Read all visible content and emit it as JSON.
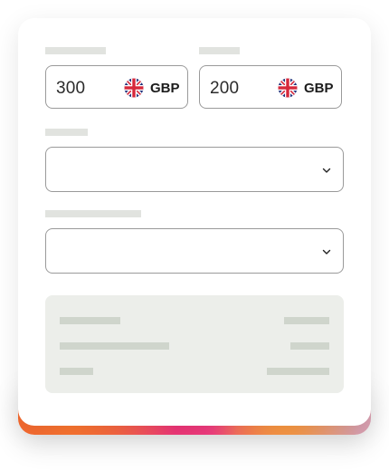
{
  "from_amount": {
    "label": "",
    "value": "300",
    "currency": "GBP",
    "flag_icon": "uk-flag-icon"
  },
  "to_amount": {
    "label": "",
    "value": "200",
    "currency": "GBP",
    "flag_icon": "uk-flag-icon"
  },
  "select_one": {
    "label": "",
    "value": "",
    "icon": "chevron-down-icon"
  },
  "select_two": {
    "label": "",
    "value": "",
    "icon": "chevron-down-icon"
  },
  "summary": {
    "rows": [
      {
        "label": "",
        "value": ""
      },
      {
        "label": "",
        "value": ""
      },
      {
        "label": "",
        "value": ""
      }
    ]
  },
  "colors": {
    "border": "#9a9a9a",
    "placeholder_bar": "#e1e3df",
    "summary_bg": "#eceeea",
    "summary_bar": "#cfd5cc",
    "accent_gradient": [
      "#ee5a2f",
      "#f24c6a",
      "#f5418a",
      "#f7884a",
      "#e3a6b8"
    ]
  }
}
